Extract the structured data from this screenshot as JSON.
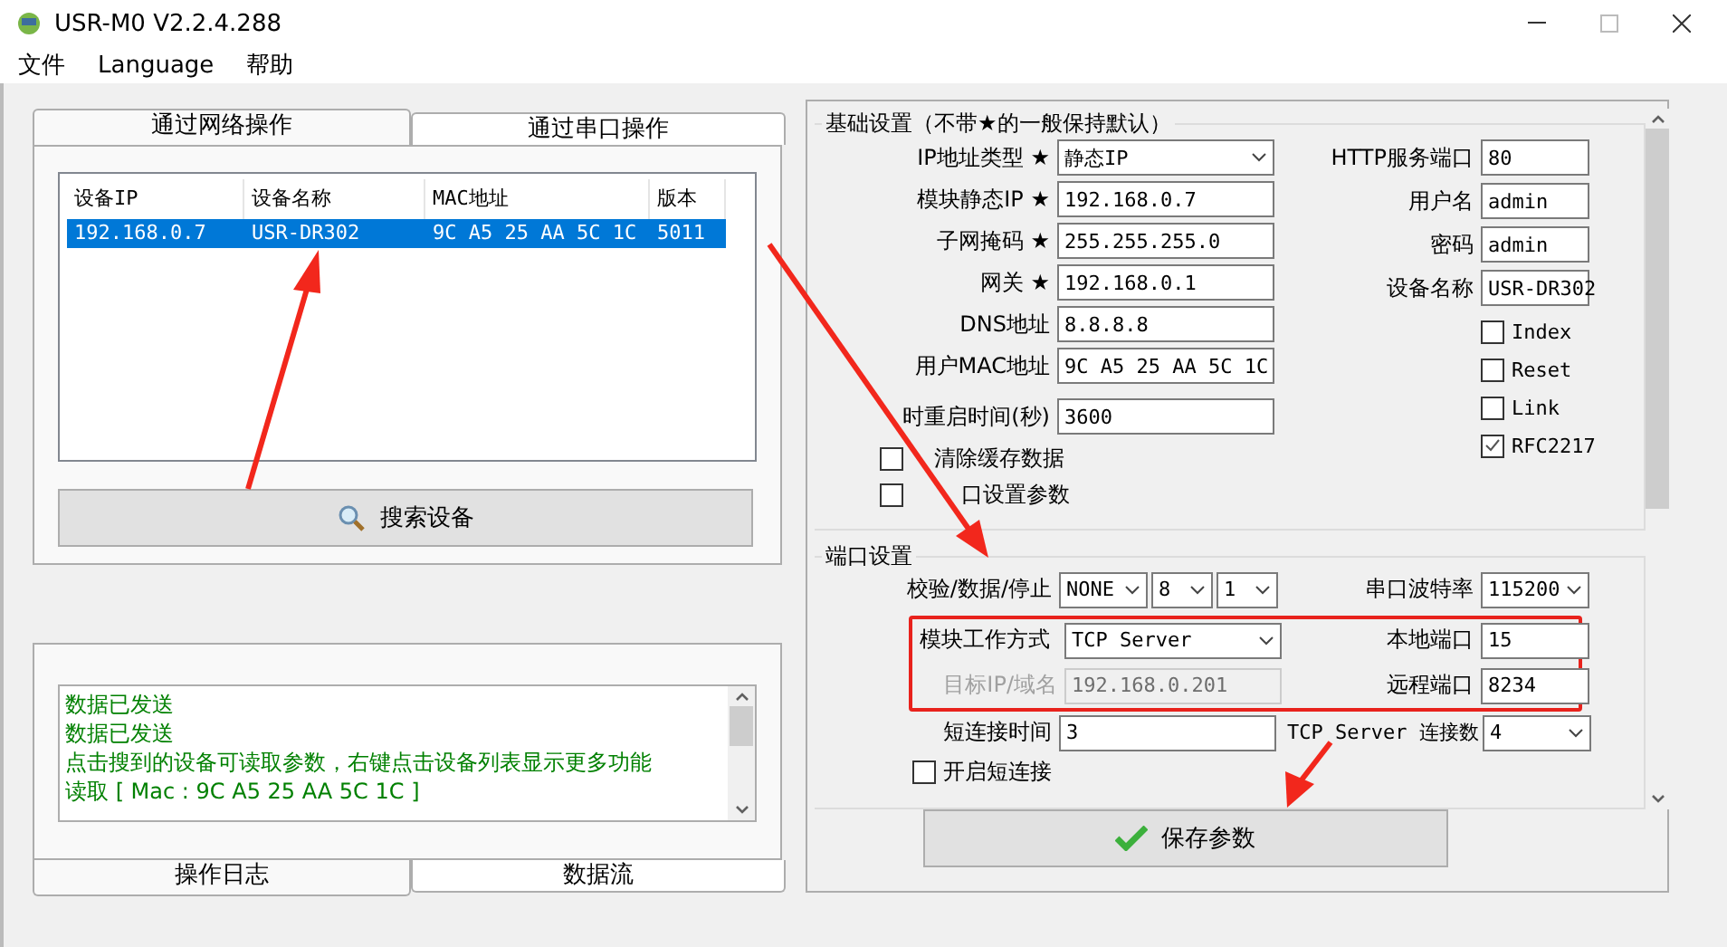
{
  "window": {
    "title": "USR-M0 V2.2.4.288"
  },
  "menu": [
    "文件",
    "Language",
    "帮助"
  ],
  "device_tabs": [
    {
      "label": "通过网络操作",
      "selected": true
    },
    {
      "label": "通过串口操作",
      "selected": false
    }
  ],
  "device_table": {
    "columns": [
      "设备IP",
      "设备名称",
      "MAC地址",
      "版本"
    ],
    "rows": [
      {
        "cells": [
          "192.168.0.7",
          "USR-DR302",
          "9C A5 25 AA 5C 1C",
          "5011"
        ],
        "selected": true
      }
    ]
  },
  "search_button": "搜索设备",
  "log": {
    "lines": [
      "数据已发送",
      "数据已发送",
      "点击搜到的设备可读取参数，右键点击设备列表显示更多功能",
      "读取 [ Mac : 9C A5 25 AA 5C 1C ]"
    ]
  },
  "log_tabs": [
    {
      "label": "操作日志",
      "selected": true
    },
    {
      "label": "数据流",
      "selected": false
    }
  ],
  "basic_settings": {
    "title": "基础设置（不带★的一般保持默认）",
    "fields": [
      {
        "label": "IP地址类型 ★",
        "kind": "select",
        "value": "静态IP"
      },
      {
        "label": "模块静态IP ★",
        "kind": "text",
        "value": "192.168.0.7"
      },
      {
        "label": "子网掩码 ★",
        "kind": "text",
        "value": "255.255.255.0"
      },
      {
        "label": "网关 ★",
        "kind": "text",
        "value": "192.168.0.1"
      },
      {
        "label": "DNS地址",
        "kind": "text",
        "value": "8.8.8.8"
      },
      {
        "label": "用户MAC地址",
        "kind": "text",
        "value": "9C A5 25 AA 5C 1C"
      },
      {
        "label": "时重启时间(秒)",
        "kind": "text",
        "value": "3600"
      }
    ],
    "checkboxes": [
      {
        "label": "清除缓存数据",
        "checked": false
      },
      {
        "label": "口设置参数",
        "checked": false
      }
    ],
    "right_fields": [
      {
        "label": "HTTP服务端口",
        "value": "80"
      },
      {
        "label": "用户名",
        "value": "admin"
      },
      {
        "label": "密码",
        "value": "admin"
      },
      {
        "label": "设备名称",
        "value": "USR-DR302"
      }
    ],
    "options": [
      {
        "label": "Index",
        "checked": false
      },
      {
        "label": "Reset",
        "checked": false
      },
      {
        "label": "Link",
        "checked": false
      },
      {
        "label": "RFC2217",
        "checked": true
      }
    ]
  },
  "port_settings": {
    "title": "端口设置",
    "parity": {
      "label": "校验/数据/停止",
      "values": [
        "NONE",
        "8",
        "1"
      ]
    },
    "baud": {
      "label": "串口波特率",
      "value": "115200"
    },
    "mode": {
      "label": "模块工作方式",
      "value": "TCP Server"
    },
    "target": {
      "label": "目标IP/域名",
      "value": "192.168.0.201",
      "disabled": true
    },
    "local_port": {
      "label": "本地端口",
      "value": "15"
    },
    "remote_port": {
      "label": "远程端口",
      "value": "8234"
    },
    "short_time": {
      "label": "短连接时间",
      "value": "3"
    },
    "connections": {
      "label": "TCP Server 连接数",
      "value": "4"
    },
    "short_connect": {
      "label": "开启短连接",
      "checked": false
    }
  },
  "save_button": "保存参数"
}
